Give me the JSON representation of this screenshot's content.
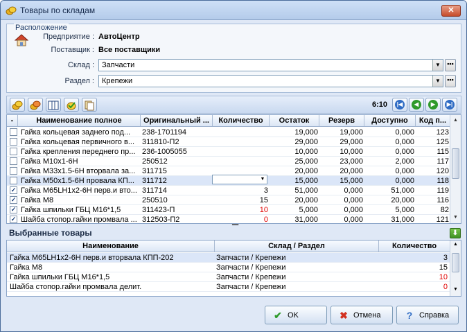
{
  "window": {
    "title": "Товары по складам",
    "close_label": "✕"
  },
  "location": {
    "legend": "Расположение",
    "enterprise_label": "Предприятие :",
    "enterprise_value": "АвтоЦентр",
    "supplier_label": "Поставщик :",
    "supplier_value": "Все поставщики",
    "warehouse_label": "Склад :",
    "warehouse_value": "Запчасти",
    "section_label": "Раздел :",
    "section_value": "Крепежи",
    "dots_label": "•••"
  },
  "toolbar": {
    "icons": [
      "coins-yellow-icon",
      "coins-red-icon",
      "columns-icon",
      "check-money-icon",
      "copy-icon"
    ],
    "pager": "6:10"
  },
  "products": {
    "columns": [
      "-",
      "Наименование полное",
      "Оригинальный ...",
      "Количество",
      "Остаток",
      "Резерв",
      "Доступно",
      "Код п..."
    ],
    "rows": [
      {
        "checked": false,
        "name": "Гайка кольцевая заднего под...",
        "orig": "238-1701194",
        "qty": "",
        "rest": "19,000",
        "reserve": "19,000",
        "avail": "0,000",
        "code": "123",
        "qty_red": false
      },
      {
        "checked": false,
        "name": "Гайка кольцевая первичного в...",
        "orig": "311810-П2",
        "qty": "",
        "rest": "29,000",
        "reserve": "29,000",
        "avail": "0,000",
        "code": "125",
        "qty_red": false
      },
      {
        "checked": false,
        "name": "Гайка крепления переднего пр...",
        "orig": "236-1005055",
        "qty": "",
        "rest": "10,000",
        "reserve": "10,000",
        "avail": "0,000",
        "code": "115",
        "qty_red": false
      },
      {
        "checked": false,
        "name": "Гайка М10х1-6Н",
        "orig": "250512",
        "qty": "",
        "rest": "25,000",
        "reserve": "23,000",
        "avail": "2,000",
        "code": "117",
        "qty_red": false
      },
      {
        "checked": false,
        "name": "Гайка М33х1.5-6Н вторвала за...",
        "orig": "311715",
        "qty": "",
        "rest": "20,000",
        "reserve": "20,000",
        "avail": "0,000",
        "code": "120",
        "qty_red": false
      },
      {
        "checked": false,
        "name": "Гайка М50х1.5-6Н провала КП...",
        "orig": "311712",
        "qty": "",
        "rest": "15,000",
        "reserve": "15,000",
        "avail": "0,000",
        "code": "118",
        "qty_red": false
      },
      {
        "checked": true,
        "name": "Гайка М65LН1х2-6Н перв.и вто...",
        "orig": "311714",
        "qty": "3",
        "rest": "51,000",
        "reserve": "0,000",
        "avail": "51,000",
        "code": "119",
        "qty_red": false
      },
      {
        "checked": true,
        "name": "Гайка М8",
        "orig": "250510",
        "qty": "15",
        "rest": "20,000",
        "reserve": "0,000",
        "avail": "20,000",
        "code": "116",
        "qty_red": false
      },
      {
        "checked": true,
        "name": "Гайка шпильки ГБЦ М16*1,5",
        "orig": "311423-П",
        "qty": "10",
        "rest": "5,000",
        "reserve": "0,000",
        "avail": "5,000",
        "code": "82",
        "qty_red": true
      },
      {
        "checked": true,
        "name": "Шайба стопор.гайки промвала ...",
        "orig": "312503-П2",
        "qty": "0",
        "rest": "31,000",
        "reserve": "0,000",
        "avail": "31,000",
        "code": "121",
        "qty_red": true
      }
    ]
  },
  "selected": {
    "title": "Выбранные товары",
    "columns": [
      "Наименование",
      "Склад / Раздел",
      "Количество"
    ],
    "rows": [
      {
        "name": "Гайка М65LН1х2-6Н перв.и вторвала КПП-202",
        "place": "Запчасти / Крепежи",
        "qty": "3",
        "qty_red": false
      },
      {
        "name": "Гайка М8",
        "place": "Запчасти / Крепежи",
        "qty": "15",
        "qty_red": false
      },
      {
        "name": "Гайка шпильки ГБЦ М16*1,5",
        "place": "Запчасти / Крепежи",
        "qty": "10",
        "qty_red": true
      },
      {
        "name": "Шайба стопор.гайки промвала делит.",
        "place": "Запчасти / Крепежи",
        "qty": "0",
        "qty_red": true
      }
    ]
  },
  "buttons": {
    "ok": "OK",
    "cancel": "Отмена",
    "help": "Справка"
  }
}
